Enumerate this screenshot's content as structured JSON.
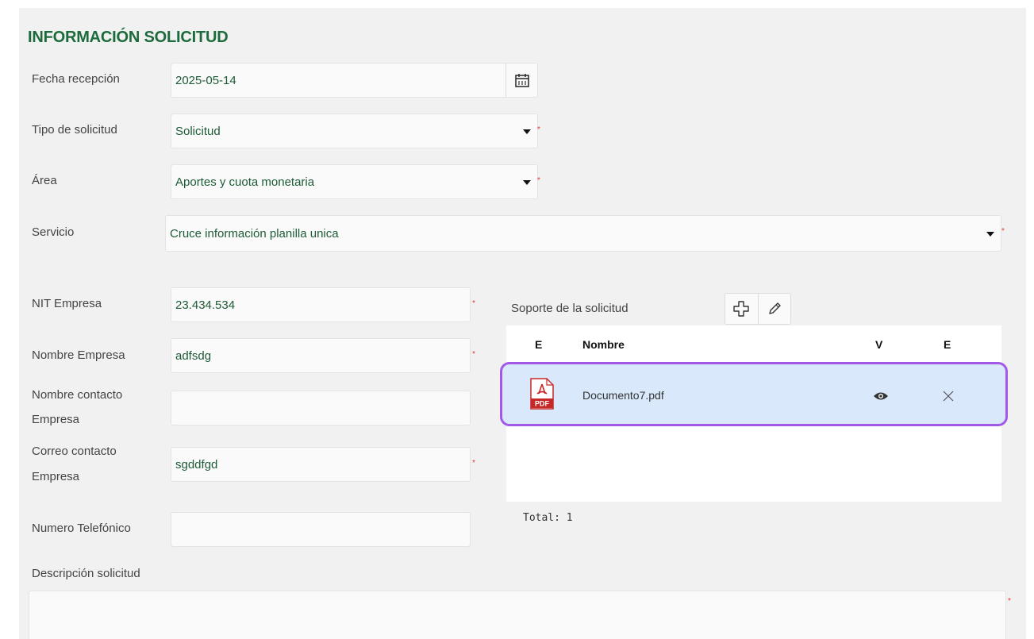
{
  "section_title": "INFORMACIÓN SOLICITUD",
  "fields": {
    "fecha_recepcion": {
      "label": "Fecha recepción",
      "value": "2025-05-14"
    },
    "tipo_solicitud": {
      "label": "Tipo de solicitud",
      "value": "Solicitud",
      "required_mark": "*"
    },
    "area": {
      "label": "Área",
      "value": "Aportes y cuota monetaria",
      "required_mark": "*"
    },
    "servicio": {
      "label": "Servicio",
      "value": "Cruce información planilla unica",
      "required_mark": "*"
    },
    "nit_empresa": {
      "label": "NIT Empresa",
      "value": "23.434.534",
      "required_mark": "*"
    },
    "nombre_empresa": {
      "label": "Nombre Empresa",
      "value": "adfsdg",
      "required_mark": "*"
    },
    "nombre_contacto": {
      "label_line1": "Nombre contacto",
      "label_line2": "Empresa",
      "value": ""
    },
    "correo_contacto": {
      "label_line1": "Correo contacto",
      "label_line2": "Empresa",
      "value": "sgddfgd",
      "required_mark": "*"
    },
    "numero_telefonico": {
      "label": "Numero Telefónico",
      "value": ""
    },
    "descripcion": {
      "label": "Descripción solicitud",
      "value": "",
      "required_mark": "*"
    }
  },
  "attachments": {
    "label": "Soporte de la solicitud",
    "columns": [
      "E",
      "Nombre",
      "V",
      "E"
    ],
    "rows": [
      {
        "icon": "pdf-file-icon",
        "icon_text": "PDF",
        "name": "Documento7.pdf",
        "view_icon": "eye-icon",
        "delete_icon": "close-icon"
      }
    ],
    "total": "Total: 1"
  },
  "icons": {
    "calendar": "calendar-icon",
    "dropdown": "chevron-down-icon",
    "add": "plus-icon",
    "edit": "pencil-icon"
  },
  "colors": {
    "title": "#1d6b3c",
    "value_text": "#1d5a36",
    "required": "#e53935",
    "highlight_border": "#a259e8",
    "selected_row": "#d9e9fb"
  }
}
